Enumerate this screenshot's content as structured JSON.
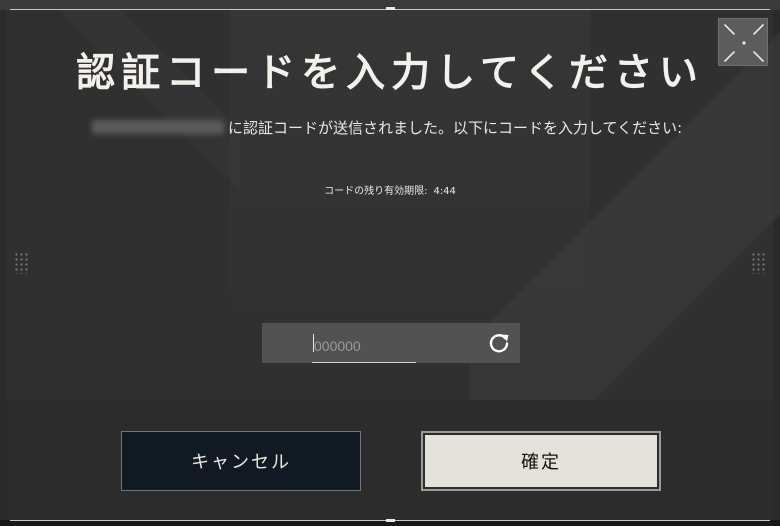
{
  "dialog": {
    "title": "認証コードを入力してください",
    "message": "に認証コードが送信されました。以下にコードを入力してください:",
    "timer_label": "コードの残り有効期限:",
    "timer_value": "4:44"
  },
  "code_input": {
    "placeholder": "000000",
    "value": ""
  },
  "buttons": {
    "cancel_label": "キャンセル",
    "confirm_label": "確定"
  },
  "icons": {
    "expand": "expand-icon",
    "refresh": "refresh-icon"
  },
  "colors": {
    "cancel_bg": "#111923",
    "confirm_bg": "#e5e2dc",
    "text": "#ece8e1"
  }
}
